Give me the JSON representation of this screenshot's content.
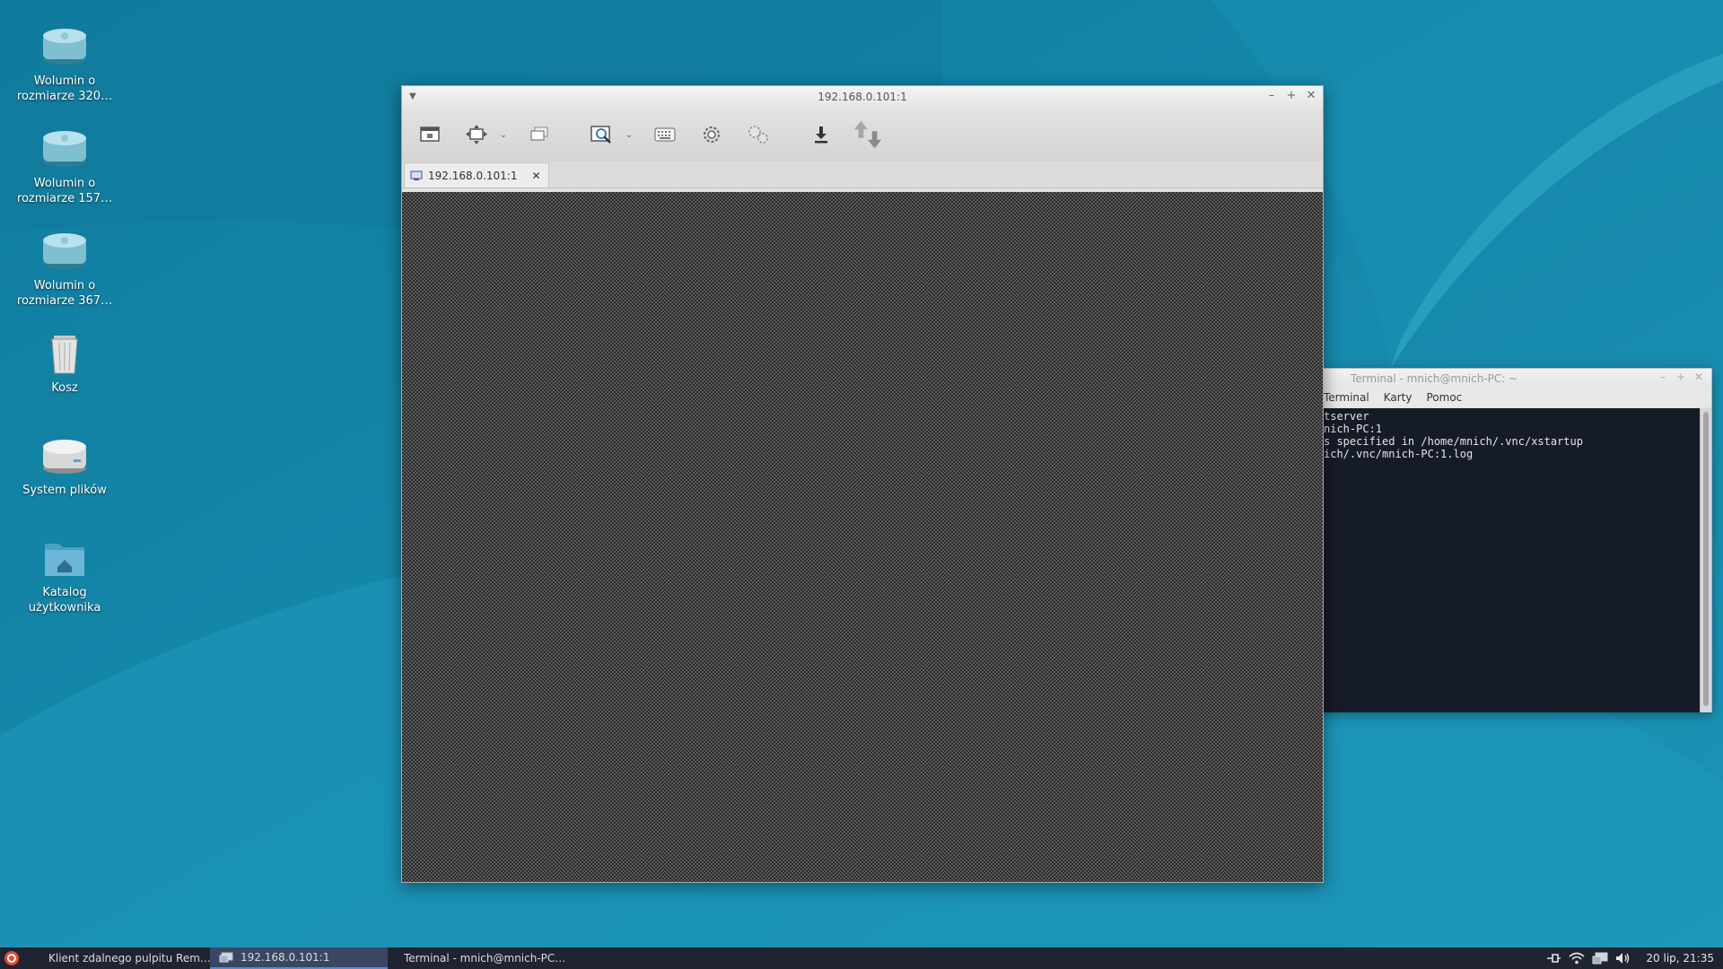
{
  "desktop": {
    "icons": [
      {
        "label": "Wolumin o rozmiarze 320…",
        "icon": "drive-icon"
      },
      {
        "label": "Wolumin o rozmiarze 157…",
        "icon": "drive-icon"
      },
      {
        "label": "Wolumin o rozmiarze 367…",
        "icon": "drive-icon"
      },
      {
        "label": "Kosz",
        "icon": "trash-icon"
      },
      {
        "label": "System plików",
        "icon": "filesystem-icon"
      },
      {
        "label": "Katalog użytkownika",
        "icon": "home-folder-icon"
      }
    ]
  },
  "remmina": {
    "title": "192.168.0.101:1",
    "tab_label": "192.168.0.101:1",
    "toolbar_icons": [
      "window-toggle-icon",
      "scale-icon",
      "dropdown-icon",
      "multi-monitor-icon",
      "zoom-icon",
      "dropdown-icon",
      "keyboard-icon",
      "preferences-icon",
      "tools-icon",
      "download-icon",
      "transfer-icon"
    ]
  },
  "terminal": {
    "title": "Terminal - mnich@mnich-PC: ~",
    "menu": [
      "Terminal",
      "Karty",
      "Pomoc"
    ],
    "lines": [
      "tserver",
      "",
      "nich-PC:1",
      "",
      "s specified in /home/mnich/.vnc/xstartup",
      "ich/.vnc/mnich-PC:1.log"
    ]
  },
  "taskbar": {
    "tasks": [
      {
        "label": "Klient zdalnego pulpitu Rem…",
        "active": false
      },
      {
        "label": "192.168.0.101:1",
        "active": true
      },
      {
        "label": "Terminal - mnich@mnich-PC…",
        "active": false
      }
    ],
    "clock": "20 lip, 21:35",
    "tray_icons": [
      "network-wired-icon",
      "wifi-icon",
      "remmina-tray-icon",
      "volume-icon"
    ]
  },
  "colors": {
    "desktop_bg": "#1688a9",
    "taskbar_bg": "#1f2430",
    "terminal_bg": "#161b28",
    "taskbar_active": "#3a4663"
  }
}
